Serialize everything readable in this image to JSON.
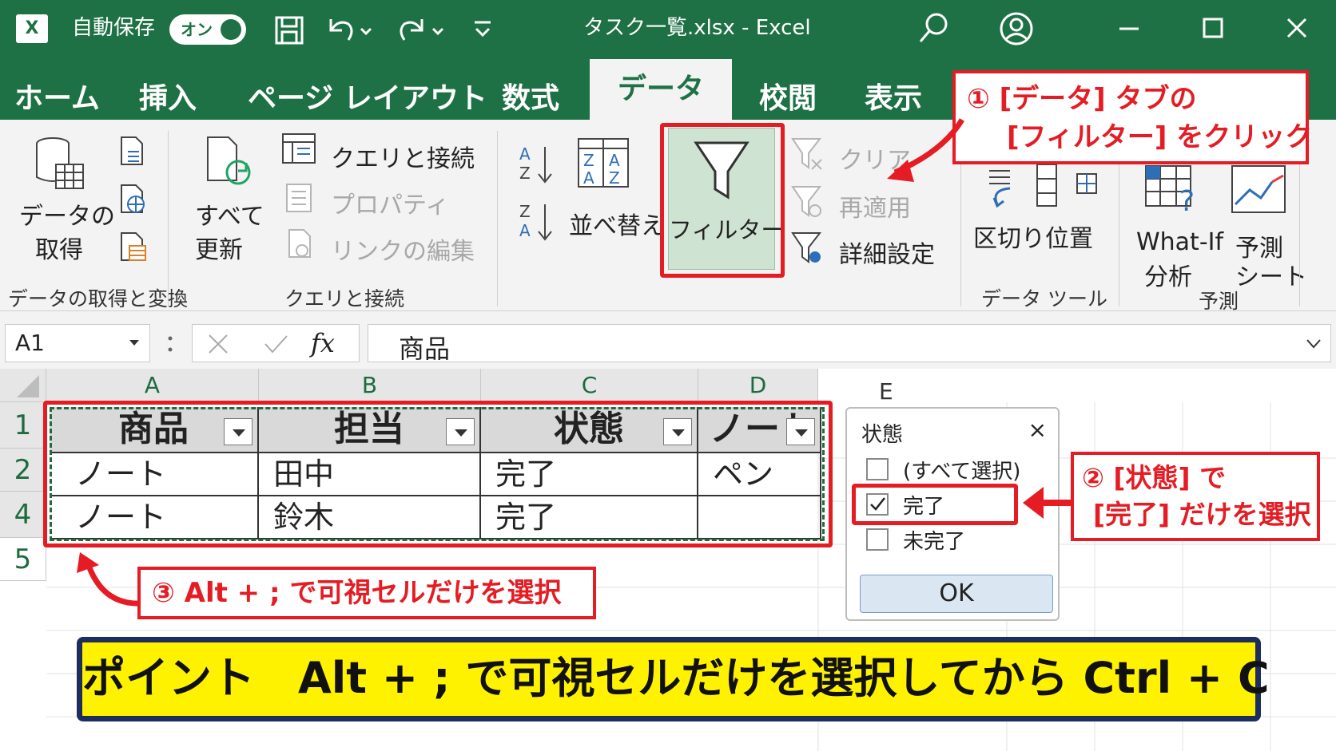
{
  "titlebar": {
    "autosave_label": "自動保存",
    "autosave_toggle": "オン",
    "file_title": "タスク一覧.xlsx  -  Excel",
    "app_icon": "excel-icon"
  },
  "tabs": [
    "ホーム",
    "挿入",
    "ページ レイアウト",
    "数式",
    "データ",
    "校閲",
    "表示"
  ],
  "ribbon": {
    "get_data": [
      "データの",
      "取得"
    ],
    "group_get": "データの取得と変換",
    "refresh_all": [
      "すべて",
      "更新"
    ],
    "query_connect": "クエリと接続",
    "properties": "プロパティ",
    "edit_links": "リンクの編集",
    "group_query": "クエリと接続",
    "sort": "並べ替え",
    "filter": "フィルター",
    "clear": "クリア",
    "reapply": "再適用",
    "advanced": "詳細設定",
    "text_to_columns": "区切り位置",
    "group_data_tools": "データ ツール",
    "whatif": [
      "What-If",
      "分析"
    ],
    "forecast_sheet": [
      "予測",
      "シート"
    ],
    "group_forecast": "予測"
  },
  "formula_bar": {
    "name_box": "A1",
    "fx": "fx",
    "content": "商品"
  },
  "sheet": {
    "columns": [
      "A",
      "B",
      "C",
      "D",
      "E"
    ],
    "rows": [
      "1",
      "2",
      "4",
      "5"
    ],
    "header": [
      "商品",
      "担当",
      "状態",
      "ノート"
    ],
    "data": [
      [
        "ノート",
        "田中",
        "完了",
        "ペン"
      ],
      [
        "ノート",
        "鈴木",
        "完了",
        ""
      ]
    ]
  },
  "filter_panel": {
    "title": "状態",
    "close": "×",
    "items": [
      {
        "label": "(すべて選択)",
        "checked": false
      },
      {
        "label": "完了",
        "checked": true
      },
      {
        "label": "未完了",
        "checked": false
      }
    ],
    "ok": "OK"
  },
  "callouts": {
    "step1_line1": "① [データ] タブの",
    "step1_line2": "[フィルター] をクリック",
    "step2_line1": "② [状態] で",
    "step2_line2": "[完了] だけを選択",
    "step3": "③ Alt + ; で可視セルだけを選択"
  },
  "point": "ポイント　Alt + ; で可視セルだけを選択してから Ctrl + C",
  "colors": {
    "excel_green": "#1e7145",
    "callout_red": "#e51c23",
    "point_yellow": "#fff200",
    "point_border": "#1c2d5e"
  }
}
